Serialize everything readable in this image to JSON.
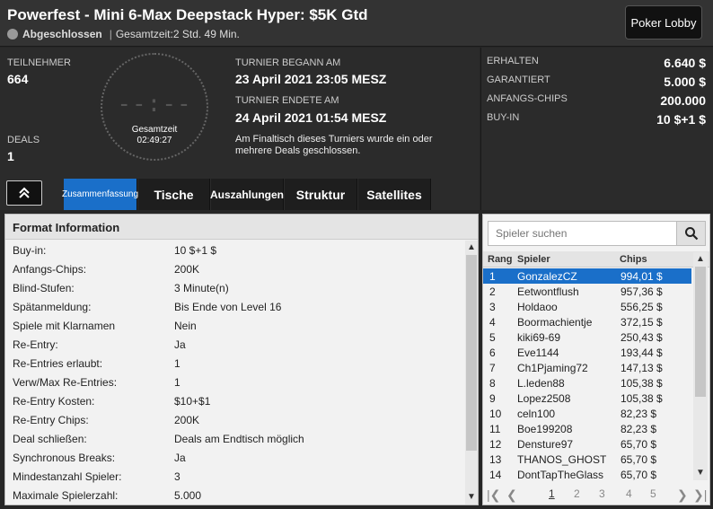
{
  "header": {
    "title": "Powerfest - Mini 6-Max Deepstack Hyper: $5K Gtd",
    "status": "Abgeschlossen",
    "separator": "|",
    "duration": "Gesamtzeit:2 Std.  49 Min.",
    "lobby_button": "Poker Lobby"
  },
  "info": {
    "participants_label": "TEILNEHMER",
    "participants_value": "664",
    "deals_label": "DEALS",
    "deals_value": "1",
    "clock_digits": "--:--",
    "clock_label": "Gesamtzeit",
    "clock_time": "02:49:27",
    "start_label": "TURNIER BEGANN AM",
    "start_value": "23 April 2021  23:05 MESZ",
    "end_label": "TURNIER ENDETE AM",
    "end_value": "24 April 2021  01:54 MESZ",
    "deal_note": "Am Finaltisch dieses Turniers wurde ein oder mehrere Deals geschlossen."
  },
  "prize": {
    "rows": [
      {
        "label": "ERHALTEN",
        "value": "6.640 $"
      },
      {
        "label": "GARANTIERT",
        "value": "5.000 $"
      },
      {
        "label": "ANFANGS-CHIPS",
        "value": "200.000"
      },
      {
        "label": "BUY-IN",
        "value": "10 $+1 $"
      }
    ]
  },
  "tabs": [
    {
      "label": "Zusammenfassung"
    },
    {
      "label": "Tische"
    },
    {
      "label": "Auszahlungen"
    },
    {
      "label": "Struktur"
    },
    {
      "label": "Satellites"
    }
  ],
  "format": {
    "title": "Format Information",
    "rows": [
      {
        "label": "Buy-in:",
        "value": "10 $+1 $"
      },
      {
        "label": "Anfangs-Chips:",
        "value": "200K"
      },
      {
        "label": "Blind-Stufen:",
        "value": "3 Minute(n)"
      },
      {
        "label": "Spätanmeldung:",
        "value": "Bis Ende von Level 16"
      },
      {
        "label": "Spiele mit Klarnamen",
        "value": "Nein"
      },
      {
        "label": "Re-Entry:",
        "value": "Ja"
      },
      {
        "label": "Re-Entries erlaubt:",
        "value": "1"
      },
      {
        "label": "Verw/Max Re-Entries:",
        "value": "1"
      },
      {
        "label": "Re-Entry Kosten:",
        "value": "$10+$1"
      },
      {
        "label": "Re-Entry Chips:",
        "value": "200K"
      },
      {
        "label": "Deal schließen:",
        "value": "Deals am Endtisch möglich"
      },
      {
        "label": "Synchronous Breaks:",
        "value": "Ja"
      },
      {
        "label": "Mindestanzahl Spieler:",
        "value": "3"
      },
      {
        "label": "Maximale Spielerzahl:",
        "value": "5.000"
      }
    ]
  },
  "players": {
    "search_placeholder": "Spieler suchen",
    "columns": [
      "Rang",
      "Spieler",
      "Chips"
    ],
    "rows": [
      {
        "rank": "1",
        "name": "GonzalezCZ",
        "chips": "994,01 $"
      },
      {
        "rank": "2",
        "name": "Eetwontflush",
        "chips": "957,36 $"
      },
      {
        "rank": "3",
        "name": "Holdaoo",
        "chips": "556,25 $"
      },
      {
        "rank": "4",
        "name": "Boormachientje",
        "chips": "372,15 $"
      },
      {
        "rank": "5",
        "name": "kiki69-69",
        "chips": "250,43 $"
      },
      {
        "rank": "6",
        "name": "Eve1144",
        "chips": "193,44 $"
      },
      {
        "rank": "7",
        "name": "Ch1Pjaming72",
        "chips": "147,13 $"
      },
      {
        "rank": "8",
        "name": "L.leden88",
        "chips": "105,38 $"
      },
      {
        "rank": "9",
        "name": "Lopez2508",
        "chips": "105,38 $"
      },
      {
        "rank": "10",
        "name": "celn100",
        "chips": "82,23 $"
      },
      {
        "rank": "11",
        "name": "Boe199208",
        "chips": "82,23 $"
      },
      {
        "rank": "12",
        "name": "Densture97",
        "chips": "65,70 $"
      },
      {
        "rank": "13",
        "name": "THANOS_GHOST",
        "chips": "65,70 $"
      },
      {
        "rank": "14",
        "name": "DontTapTheGlass",
        "chips": "65,70 $"
      }
    ],
    "pages": [
      "1",
      "2",
      "3",
      "4",
      "5"
    ]
  },
  "colors": {
    "accent": "#1a6fc9",
    "background": "#262626"
  }
}
